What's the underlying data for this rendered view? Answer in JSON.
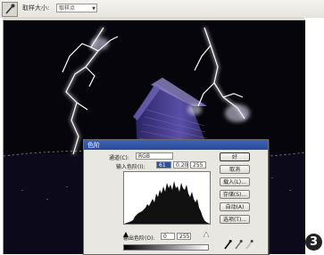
{
  "options_bar": {
    "tool_icon": "eyedropper-tool-icon",
    "sample_size_label": "取样大小:",
    "sample_size_value": "取样点"
  },
  "levels_dialog": {
    "title": "色阶",
    "channel_label": "通道(C):",
    "channel_value": "RGB",
    "input_levels_label": "输入色阶(I):",
    "input_black": "61",
    "input_gamma": "0.20",
    "input_white": "255",
    "output_levels_label": "输出色阶(O):",
    "output_black": "0",
    "output_white": "255",
    "buttons": {
      "ok": "好",
      "cancel": "取消",
      "load": "载入(L)...",
      "save": "存储(S)...",
      "auto": "自动(A)",
      "options": "选项(T)..."
    },
    "eyedropper_icons": [
      "black-eyedropper-icon",
      "gray-eyedropper-icon",
      "white-eyedropper-icon"
    ]
  },
  "step_badge": "3",
  "colors": {
    "canvas_bg": "#07050c",
    "lightning": "#ffffff",
    "house_tint": "#4a3f8c",
    "dialog_bg": "#e9e7e1",
    "title_bar": "#2f56ad"
  }
}
